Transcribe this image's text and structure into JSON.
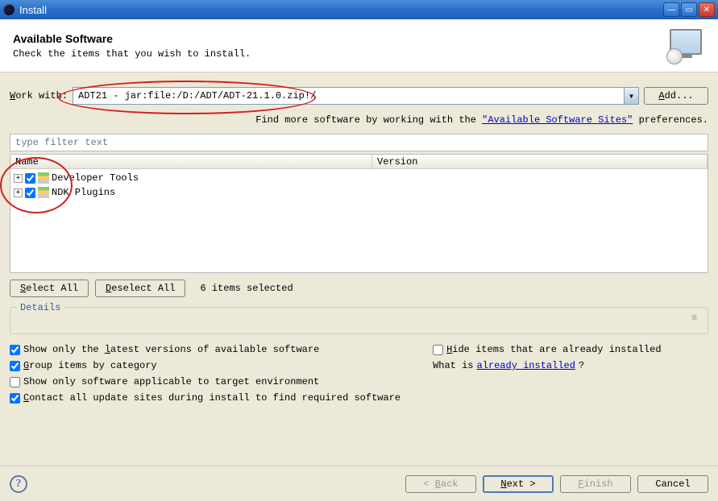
{
  "window": {
    "title": "Install"
  },
  "header": {
    "title": "Available Software",
    "subtitle": "Check the items that you wish to install."
  },
  "workWith": {
    "label": "Work with:",
    "value": "ADT21 - jar:file:/D:/ADT/ADT-21.1.0.zip!/",
    "addLabel": "Add..."
  },
  "findMore": {
    "prefix": "Find more software by working with the ",
    "link": "\"Available Software Sites\"",
    "suffix": " preferences."
  },
  "filter": {
    "placeholder": "type filter text"
  },
  "columns": {
    "name": "Name",
    "version": "Version"
  },
  "treeItems": [
    {
      "label": "Developer Tools",
      "checked": true
    },
    {
      "label": "NDK Plugins",
      "checked": true
    }
  ],
  "selectAll": "Select All",
  "deselectAll": "Deselect All",
  "selectedCount": "6 items selected",
  "details": {
    "legend": "Details"
  },
  "options": {
    "latest": "Show only the latest versions of available software",
    "group": "Group items by category",
    "applicable": "Show only software applicable to target environment",
    "contact": "Contact all update sites during install to find required software",
    "hide": "Hide items that are already installed",
    "whatIsPrefix": "What is ",
    "whatIsLink": "already installed",
    "whatIsSuffix": "?"
  },
  "checks": {
    "latest": true,
    "group": true,
    "applicable": false,
    "contact": true,
    "hide": false
  },
  "footer": {
    "back": "< Back",
    "next": "Next >",
    "finish": "Finish",
    "cancel": "Cancel"
  }
}
